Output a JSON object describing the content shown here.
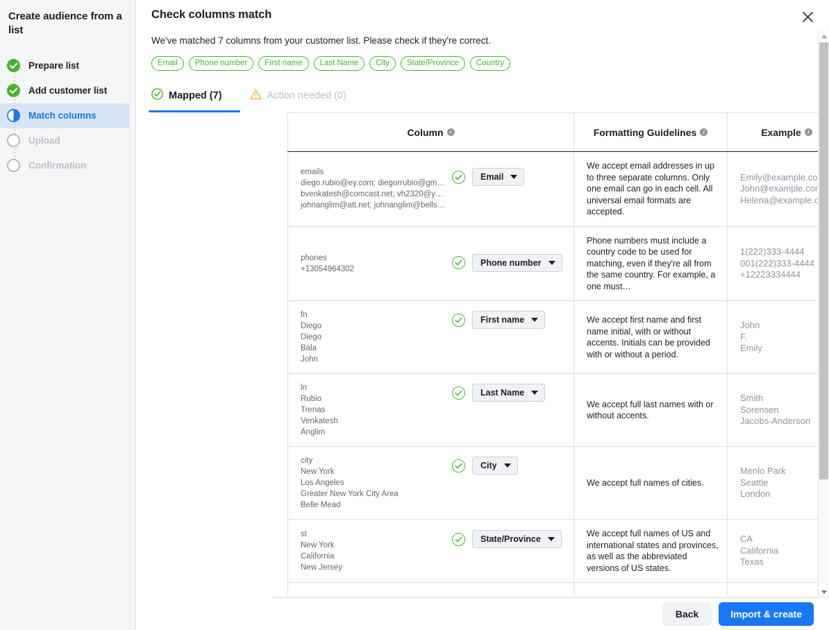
{
  "sidebar": {
    "title": "Create audience from a list",
    "items": [
      {
        "label": "Prepare list",
        "state": "done",
        "icon": "check-circle-icon"
      },
      {
        "label": "Add customer list",
        "state": "done",
        "icon": "check-circle-icon"
      },
      {
        "label": "Match columns",
        "state": "active",
        "icon": "half-circle-icon"
      },
      {
        "label": "Upload",
        "state": "pending",
        "icon": "empty-circle-icon"
      },
      {
        "label": "Confirmation",
        "state": "pending",
        "icon": "empty-circle-icon"
      }
    ]
  },
  "header": {
    "title": "Check columns match",
    "subtitle": "We've matched 7 columns from your customer list. Please check if they're correct.",
    "close_icon": "close-icon",
    "chips": [
      "Email",
      "Phone number",
      "First name",
      "Last Name",
      "City",
      "State/Province",
      "Country"
    ]
  },
  "tabs": [
    {
      "label": "Mapped (7)",
      "icon": "check-circle-icon",
      "active": true
    },
    {
      "label": "Action needed (0)",
      "icon": "warning-triangle-icon",
      "active": false
    }
  ],
  "table": {
    "headers": [
      {
        "label": "Column",
        "info": "info-icon"
      },
      {
        "label": "Formatting Guidelines",
        "info": "info-icon"
      },
      {
        "label": "Example",
        "info": "info-icon"
      }
    ],
    "rows": [
      {
        "source_name": "emails",
        "source_values": [
          "diego.rubio@ey.com; diegorrubio@gm…",
          "bvenkatesh@comcast.net; vh2320@y…",
          "johnanglim@att.net; johnanglim@bells…"
        ],
        "status_icon": "check-circle-icon",
        "mapped_to": "Email",
        "guideline": "We accept email addresses in up to three separate columns. Only one email can go in each cell. All universal email formats are accepted.",
        "examples": [
          "Emily@example.com",
          "John@example.com",
          "Helena@example.com"
        ]
      },
      {
        "source_name": "phones",
        "source_values": [
          "+13054964302"
        ],
        "status_icon": "check-circle-icon",
        "mapped_to": "Phone number",
        "guideline": "Phone numbers must include a country code to be used for matching, even if they're all from the same country. For example, a one must…",
        "examples": [
          "1(222)333-4444",
          "001(222)333-4444",
          "+12223334444"
        ]
      },
      {
        "source_name": "fn",
        "source_values": [
          "Diego",
          "Diego",
          "Bala",
          "John"
        ],
        "status_icon": "check-circle-icon",
        "mapped_to": "First name",
        "guideline": "We accept first name and first name initial, with or without accents. Initials can be provided with or without a period.",
        "examples": [
          "John",
          "F.",
          "Emily"
        ]
      },
      {
        "source_name": "ln",
        "source_values": [
          "Rubio",
          "Trenas",
          "Venkatesh",
          "Anglim"
        ],
        "status_icon": "check-circle-icon",
        "mapped_to": "Last Name",
        "guideline": "We accept full last names with or without accents.",
        "examples": [
          "Smith",
          "Sorensen",
          "Jacobs-Anderson"
        ]
      },
      {
        "source_name": "city",
        "source_values": [
          "New York",
          "Los Angeles",
          "Greater New York City Area",
          "Belle Mead"
        ],
        "status_icon": "check-circle-icon",
        "mapped_to": "City",
        "guideline": "We accept full names of cities.",
        "examples": [
          "Menlo Park",
          "Seattle",
          "London"
        ]
      },
      {
        "source_name": "st",
        "source_values": [
          "New York",
          "California",
          "New Jersey"
        ],
        "status_icon": "check-circle-icon",
        "mapped_to": "State/Province",
        "guideline": "We accept full names of US and international states and provinces, as well as the abbreviated versions of US states.",
        "examples": [
          "CA",
          "California",
          "Texas"
        ]
      }
    ]
  },
  "footer": {
    "back_label": "Back",
    "primary_label": "Import & create"
  },
  "colors": {
    "accent_blue": "#1877f2",
    "success_green": "#42b72a",
    "warning_yellow": "#f7b928",
    "text_primary": "#1c1e21",
    "text_muted": "#8d949e"
  }
}
